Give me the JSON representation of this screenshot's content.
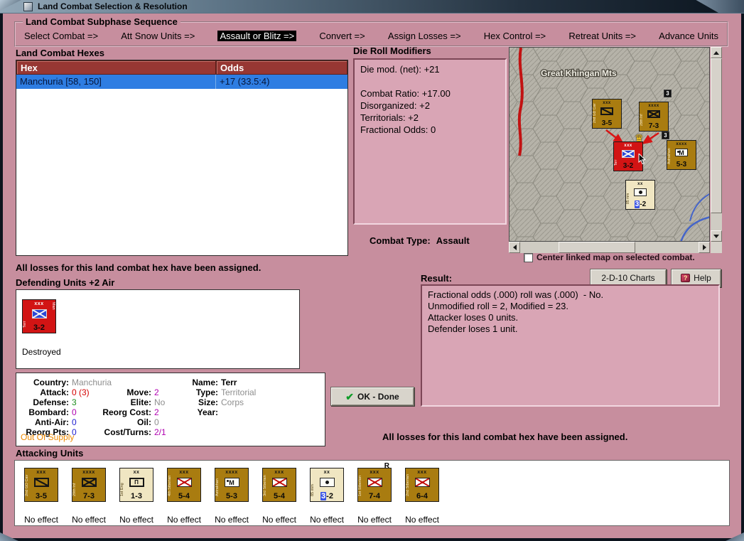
{
  "window": {
    "title": "Land Combat Selection & Resolution"
  },
  "sequence": {
    "title": "Land Combat Subphase Sequence",
    "steps": [
      "Select Combat =>",
      "Att Snow Units =>",
      "Assault or Blitz =>",
      "Convert =>",
      "Assign Losses =>",
      "Hex Control =>",
      "Retreat Units =>",
      "Advance Units"
    ],
    "active_step": "Assault or Blitz =>"
  },
  "combat_hexes": {
    "title": "Land Combat Hexes",
    "columns": {
      "hex": "Hex",
      "odds": "Odds"
    },
    "selected_row": {
      "hex": "Manchuria [58, 150]",
      "odds": "+17 (33.5:4)"
    }
  },
  "die_roll_modifiers": {
    "title": "Die Roll Modifiers",
    "lines": [
      "Die mod. (net): +21",
      "",
      "Combat Ratio: +17.00",
      "Disorganized: +2",
      "Territorials: +2",
      "Fractional Odds: 0"
    ]
  },
  "combat_type": {
    "label": "Combat Type:",
    "value": "Assault"
  },
  "map": {
    "region_label": "Great Khingan Mts",
    "units": [
      {
        "name": "2nd GD Cav",
        "size": "xxx",
        "strength": "3-5",
        "type": "cav",
        "color": "gold"
      },
      {
        "name": "29th Inf",
        "size": "xxxx",
        "strength": "7-3",
        "type": "inf",
        "color": "gold"
      },
      {
        "name": "Terr",
        "size": "xxx",
        "strength": "3-2",
        "type": "terr",
        "color": "red"
      },
      {
        "name": "Astrakhan",
        "size": "xxxx",
        "strength": "5-3",
        "type": "mech",
        "color": "gold"
      },
      {
        "name": "85 mm",
        "size": "xx",
        "strength_a": "3",
        "strength_b": "-2",
        "type": "art",
        "color": "cream"
      }
    ],
    "stack_badges": [
      "3",
      "3"
    ]
  },
  "center_map_checkbox": {
    "label": "Center linked map on selected combat.",
    "checked": false
  },
  "buttons": {
    "charts": "2-D-10 Charts",
    "help": "Help",
    "ok_done": "OK - Done"
  },
  "icons": {
    "ok_check": "✔",
    "help_glyph": "?",
    "crown": "♛"
  },
  "messages": {
    "top": "All losses for this land combat hex have been assigned.",
    "bottom": "All losses for this land combat hex have been assigned."
  },
  "defending": {
    "title": "Defending Units +2 Air",
    "unit": {
      "name": "Terr",
      "country_tag": "Man",
      "size": "xxx",
      "strength": "3-2",
      "type": "terr",
      "color": "red",
      "status": "Destroyed"
    }
  },
  "unit_details": {
    "col1": [
      {
        "label": "Country:",
        "value": "Manchuria",
        "color": "gray"
      },
      {
        "label": "Attack:",
        "value": "0 (3)",
        "color": "red"
      },
      {
        "label": "Defense:",
        "value": "3",
        "color": "green"
      },
      {
        "label": "Bombard:",
        "value": "0",
        "color": "purple"
      },
      {
        "label": "Anti-Air:",
        "value": "0",
        "color": "blue"
      },
      {
        "label": "Reorg Pts:",
        "value": "0",
        "color": "blue"
      }
    ],
    "col2": [
      {
        "label": "Move:",
        "value": "2",
        "color": "purple"
      },
      {
        "label": "Elite:",
        "value": "No",
        "color": "gray"
      },
      {
        "label": "Reorg Cost:",
        "value": "2",
        "color": "purple"
      },
      {
        "label": "Oil:",
        "value": "0",
        "color": "gray"
      },
      {
        "label": "Cost/Turns:",
        "value": "2/1",
        "color": "purple"
      }
    ],
    "col3": [
      {
        "label": "Name:",
        "value": "Terr",
        "color": "black-bold"
      },
      {
        "label": "Type:",
        "value": "Territorial",
        "color": "gray"
      },
      {
        "label": "Size:",
        "value": "Corps",
        "color": "gray"
      },
      {
        "label": "Year:",
        "value": "",
        "color": "gray"
      }
    ],
    "supply": "Out Of Supply"
  },
  "result": {
    "title": "Result:",
    "lines": [
      "Fractional odds (.000) roll was (.000)  - No.",
      "Unmodified roll = 2, Modified = 23.",
      "Attacker loses 0 units.",
      "Defender loses 1 unit."
    ]
  },
  "attacking": {
    "title": "Attacking Units",
    "units": [
      {
        "name": "2nd GD Cav",
        "size": "xxx",
        "strength": "3-5",
        "type": "cav",
        "color": "gold",
        "effect": "No effect"
      },
      {
        "name": "29th Inf",
        "size": "xxxx",
        "strength": "7-3",
        "type": "inf",
        "color": "gold",
        "effect": "No effect"
      },
      {
        "name": "1st Eng",
        "size": "xx",
        "strength": "1-3",
        "type": "eng",
        "color": "cream",
        "effect": "No effect"
      },
      {
        "name": "4th Siberian",
        "size": "xxx",
        "strength": "5-4",
        "type": "inf-white",
        "color": "gold",
        "effect": "No effect"
      },
      {
        "name": "Astrakhan",
        "size": "xxxx",
        "strength": "5-3",
        "type": "mech",
        "color": "gold",
        "effect": "No effect"
      },
      {
        "name": "3rd Siberian",
        "size": "xxx",
        "strength": "5-4",
        "type": "inf-white",
        "color": "gold",
        "effect": "No effect"
      },
      {
        "name": "85 mm",
        "size": "xx",
        "strength_a": "3",
        "strength_b": "-2",
        "type": "art",
        "color": "cream",
        "effect": "No effect"
      },
      {
        "name": "1st Siberian",
        "size": "xxx",
        "strength": "7-4",
        "type": "inf-white",
        "color": "gold",
        "effect": "No effect",
        "marker": "R"
      },
      {
        "name": "2nd Siberian",
        "size": "xxx",
        "strength": "6-4",
        "type": "inf-white",
        "color": "gold",
        "effect": "No effect"
      }
    ]
  },
  "colors": {
    "body_pink": "#c78e9e",
    "panel_pink": "#d9a5b5",
    "table_header": "#973733",
    "selection_blue": "#2e7de2",
    "supply_orange": "#ef8a00",
    "counter_gold": "#a97c10",
    "counter_red": "#d21414"
  }
}
